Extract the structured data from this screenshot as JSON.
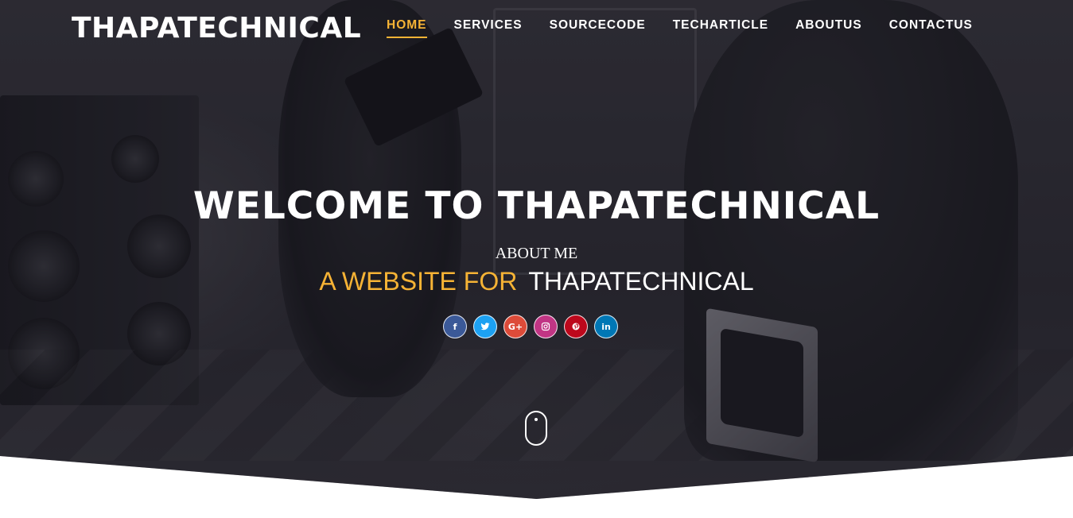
{
  "nav": {
    "brand": "THAPATECHNICAL",
    "items": [
      {
        "label": "HOME",
        "active": true
      },
      {
        "label": "SERVICES",
        "active": false
      },
      {
        "label": "SOURCECODE",
        "active": false
      },
      {
        "label": "TECHARTICLE",
        "active": false
      },
      {
        "label": "ABOUTUS",
        "active": false
      },
      {
        "label": "CONTACTUS",
        "active": false
      }
    ]
  },
  "hero": {
    "headline": "WELCOME TO THAPATECHNICAL",
    "subheading": "ABOUT ME",
    "tagline_accent": "A WEBSITE FOR",
    "tagline_plain": "THAPATECHNICAL"
  },
  "social": [
    {
      "network": "facebook",
      "glyph": "f",
      "color": "#3b5998",
      "icon": "facebook-icon"
    },
    {
      "network": "twitter",
      "glyph": "",
      "color": "#1da1f2",
      "icon": "twitter-icon"
    },
    {
      "network": "google-plus",
      "glyph": "G+",
      "color": "#dd4b39",
      "icon": "google-plus-icon"
    },
    {
      "network": "instagram",
      "glyph": "",
      "color": "#c13584",
      "icon": "instagram-icon"
    },
    {
      "network": "pinterest",
      "glyph": "",
      "color": "#bd081c",
      "icon": "pinterest-icon"
    },
    {
      "network": "linkedin",
      "glyph": "in",
      "color": "#0077b5",
      "icon": "linkedin-icon"
    }
  ],
  "colors": {
    "accent": "#f6b335",
    "text": "#ffffff",
    "page_background": "#ffffff"
  },
  "scroll_indicator": {
    "icon": "mouse-scroll-icon"
  }
}
